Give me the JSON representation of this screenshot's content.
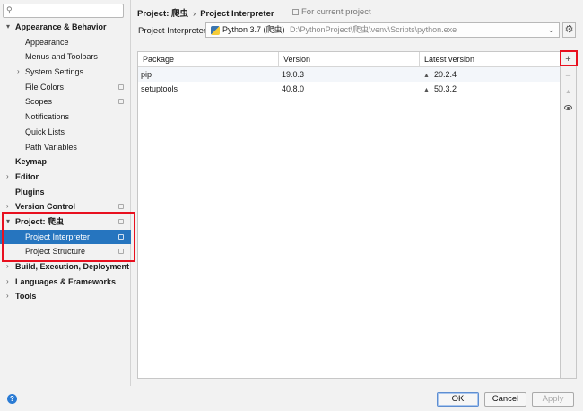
{
  "search": {
    "placeholder": "",
    "icon": "search-icon"
  },
  "sidebar": {
    "items": [
      {
        "label": "Appearance & Behavior",
        "bold": true,
        "arrow": "▾"
      },
      {
        "label": "Appearance"
      },
      {
        "label": "Menus and Toolbars"
      },
      {
        "label": "System Settings",
        "arrow": "›"
      },
      {
        "label": "File Colors"
      },
      {
        "label": "Scopes"
      },
      {
        "label": "Notifications"
      },
      {
        "label": "Quick Lists"
      },
      {
        "label": "Path Variables"
      },
      {
        "label": "Keymap",
        "bold": true
      },
      {
        "label": "Editor",
        "bold": true,
        "arrow": "›"
      },
      {
        "label": "Plugins",
        "bold": true
      },
      {
        "label": "Version Control",
        "bold": true,
        "arrow": "›"
      },
      {
        "label": "Project: 爬虫",
        "bold": true,
        "arrow": "▾"
      },
      {
        "label": "Project Interpreter"
      },
      {
        "label": "Project Structure"
      },
      {
        "label": "Build, Execution, Deployment",
        "bold": true,
        "arrow": "›"
      },
      {
        "label": "Languages & Frameworks",
        "bold": true,
        "arrow": "›"
      },
      {
        "label": "Tools",
        "bold": true,
        "arrow": "›"
      }
    ],
    "help": "?"
  },
  "header": {
    "crumb1": "Project: 爬虫",
    "separator": "›",
    "crumb2": "Project Interpreter",
    "for_current": "For current project"
  },
  "interpreter": {
    "label": "Project Interpreter:",
    "name": "Python 3.7 (爬虫)",
    "path": "D:\\PythonProject\\爬虫\\venv\\Scripts\\python.exe"
  },
  "table": {
    "columns": [
      "Package",
      "Version",
      "Latest version"
    ],
    "rows": [
      {
        "package": "pip",
        "version": "19.0.3",
        "latest": "20.2.4"
      },
      {
        "package": "setuptools",
        "version": "40.8.0",
        "latest": "50.3.2"
      }
    ]
  },
  "toolbar": {
    "add": "+",
    "remove": "−",
    "upgrade": "▲"
  },
  "buttons": {
    "ok": "OK",
    "cancel": "Cancel",
    "apply": "Apply"
  },
  "colors": {
    "selection": "#2675bf",
    "highlight": "#e8101f"
  }
}
